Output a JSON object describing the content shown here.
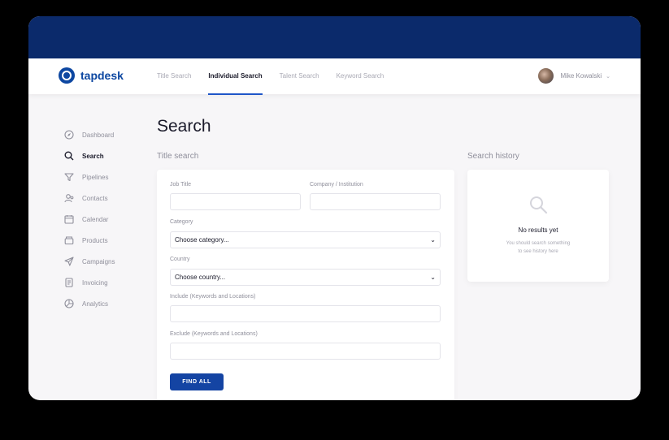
{
  "app": {
    "name": "tapdesk"
  },
  "nav": {
    "tabs": [
      {
        "label": "Title Search"
      },
      {
        "label": "Individual Search"
      },
      {
        "label": "Talent Search"
      },
      {
        "label": "Keyword Search"
      }
    ],
    "active_tab": "Individual Search"
  },
  "user": {
    "name": "Mike Kowalski"
  },
  "sidebar": {
    "items": [
      {
        "label": "Dashboard",
        "icon": "compass-icon"
      },
      {
        "label": "Search",
        "icon": "search-icon"
      },
      {
        "label": "Pipelines",
        "icon": "funnel-icon"
      },
      {
        "label": "Contacts",
        "icon": "contacts-icon"
      },
      {
        "label": "Calendar",
        "icon": "calendar-icon"
      },
      {
        "label": "Products",
        "icon": "box-icon"
      },
      {
        "label": "Campaigns",
        "icon": "send-icon"
      },
      {
        "label": "Invoicing",
        "icon": "invoice-icon"
      },
      {
        "label": "Analytics",
        "icon": "pie-chart-icon"
      }
    ],
    "active": "Search"
  },
  "page": {
    "title": "Search",
    "title_search_label": "Title search",
    "history_label": "Search history"
  },
  "form": {
    "job_title_label": "Job Title",
    "company_label": "Company / Institution",
    "category_label": "Category",
    "category_value": "Choose category...",
    "country_label": "Country",
    "country_value": "Choose country...",
    "include_label": "Include (Keywords and Locations)",
    "exclude_label": "Exclude (Keywords and Locations)",
    "submit_label": "FIND ALL"
  },
  "history": {
    "empty_title": "No results yet",
    "empty_line1": "You should search something",
    "empty_line2": "to see history here"
  },
  "colors": {
    "banner": "#0b2a6b",
    "brand": "#0d47a1",
    "button": "#1444a3",
    "accent_underline": "#1e56c8"
  }
}
